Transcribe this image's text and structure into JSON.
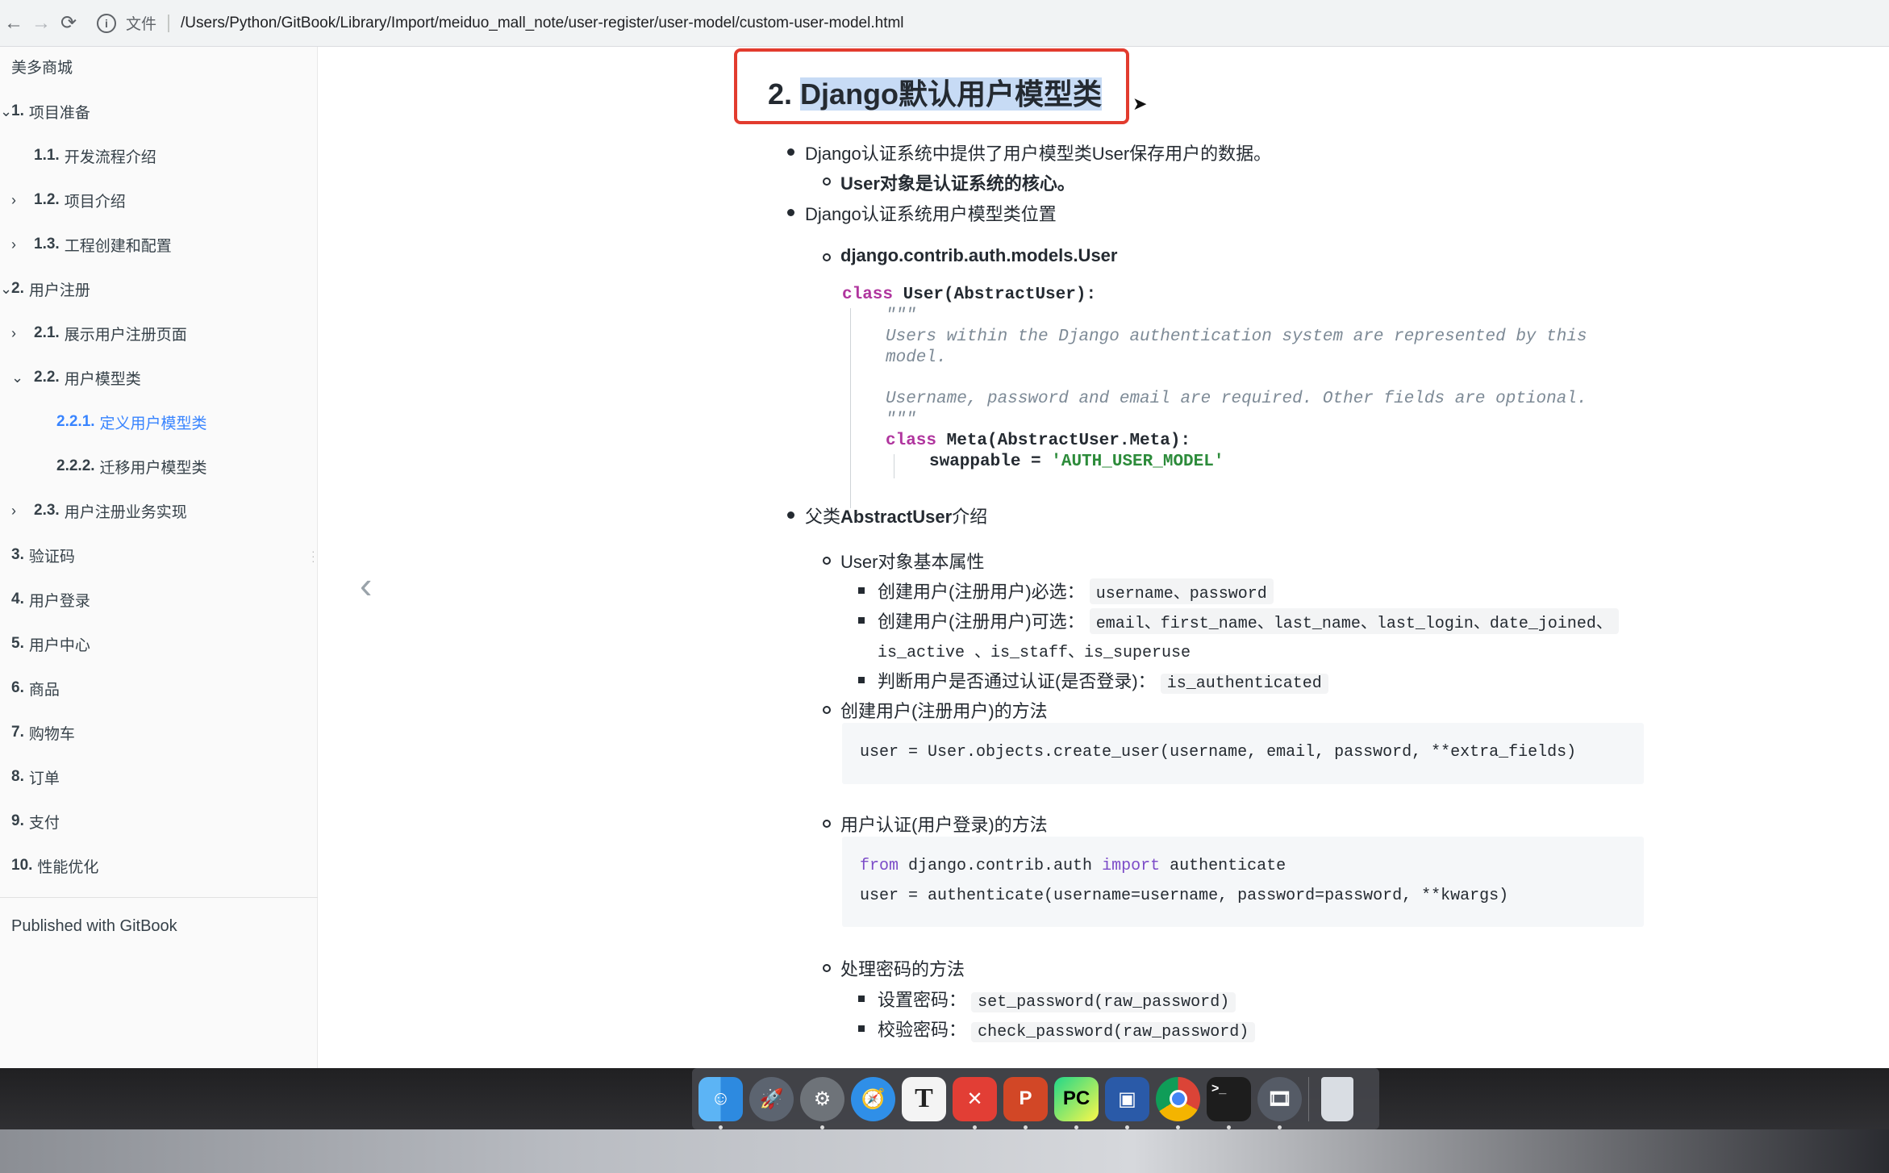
{
  "browser": {
    "scheme_label": "文件",
    "url": "/Users/Python/GitBook/Library/Import/meiduo_mall_note/user-register/user-model/custom-user-model.html"
  },
  "sidebar": {
    "title": "美多商城",
    "items": [
      {
        "num": "1.",
        "label": "项目准备"
      },
      {
        "num": "1.1.",
        "label": "开发流程介绍"
      },
      {
        "num": "1.2.",
        "label": "项目介绍"
      },
      {
        "num": "1.3.",
        "label": "工程创建和配置"
      },
      {
        "num": "2.",
        "label": "用户注册"
      },
      {
        "num": "2.1.",
        "label": "展示用户注册页面"
      },
      {
        "num": "2.2.",
        "label": "用户模型类"
      },
      {
        "num": "2.2.1.",
        "label": "定义用户模型类"
      },
      {
        "num": "2.2.2.",
        "label": "迁移用户模型类"
      },
      {
        "num": "2.3.",
        "label": "用户注册业务实现"
      },
      {
        "num": "3.",
        "label": "验证码"
      },
      {
        "num": "4.",
        "label": "用户登录"
      },
      {
        "num": "5.",
        "label": "用户中心"
      },
      {
        "num": "6.",
        "label": "商品"
      },
      {
        "num": "7.",
        "label": "购物车"
      },
      {
        "num": "8.",
        "label": "订单"
      },
      {
        "num": "9.",
        "label": "支付"
      },
      {
        "num": "10.",
        "label": "性能优化"
      }
    ],
    "footer": "Published with GitBook"
  },
  "content": {
    "heading_num": "2.",
    "heading_text": "Django默认用户模型类",
    "p1": "Django认证系统中提供了用户模型类User保存用户的数据。",
    "p1_sub": "User对象是认证系统的核心。",
    "p2": "Django认证系统用户模型类位置",
    "p2_sub": "django.contrib.auth.models.User",
    "code1": {
      "l1_kw": "class",
      "l1_rest": " User(AbstractUser):",
      "l2": "\"\"\"",
      "l3": "Users within the Django authentication system are represented by this",
      "l4": "model.",
      "l5": "Username, password and email are required. Other fields are optional.",
      "l6": "\"\"\"",
      "l7_kw": "class",
      "l7_rest": " Meta(AbstractUser.Meta):",
      "l8_a": "swappable = ",
      "l8_str": "'AUTH_USER_MODEL'"
    },
    "p3_a": "父类",
    "p3_b": "AbstractUser",
    "p3_c": "介绍",
    "attrs_title": "User对象基本属性",
    "attr1_label": "创建用户(注册用户)必选：",
    "attr1_code": "username、password",
    "attr2_label": "创建用户(注册用户)可选：",
    "attr2_code": "email、first_name、last_name、last_login、date_joined、",
    "attr2_code2": "is_active 、is_staff、is_superuse",
    "attr3_label": "判断用户是否通过认证(是否登录)：",
    "attr3_code": "is_authenticated",
    "create_title": "创建用户(注册用户)的方法",
    "create_code": "user = User.objects.create_user(username, email, password, **extra_fields)",
    "auth_title": "用户认证(用户登录)的方法",
    "auth_l1_from": "from",
    "auth_l1_mid": " django.contrib.auth ",
    "auth_l1_import": "import",
    "auth_l1_end": " authenticate",
    "auth_l2": "user = authenticate(username=username, password=password, **kwargs)",
    "pwd_title": "处理密码的方法",
    "pwd1_label": "设置密码：",
    "pwd1_code": "set_password(raw_password)",
    "pwd2_label": "校验密码：",
    "pwd2_code": "check_password(raw_password)"
  },
  "dock": {
    "icons": [
      "finder-icon",
      "launchpad-icon",
      "system-preferences-icon",
      "safari-icon",
      "typora-icon",
      "xmind-icon",
      "powerpoint-icon",
      "pycharm-icon",
      "virtualbox-icon",
      "chrome-icon",
      "terminal-icon",
      "gif-tool-icon",
      "trash-icon"
    ]
  },
  "colors": {
    "accent": "#3884ff",
    "highlight_box": "#e23b2e",
    "keyword": "#b0359e",
    "string": "#2c8b3a"
  }
}
